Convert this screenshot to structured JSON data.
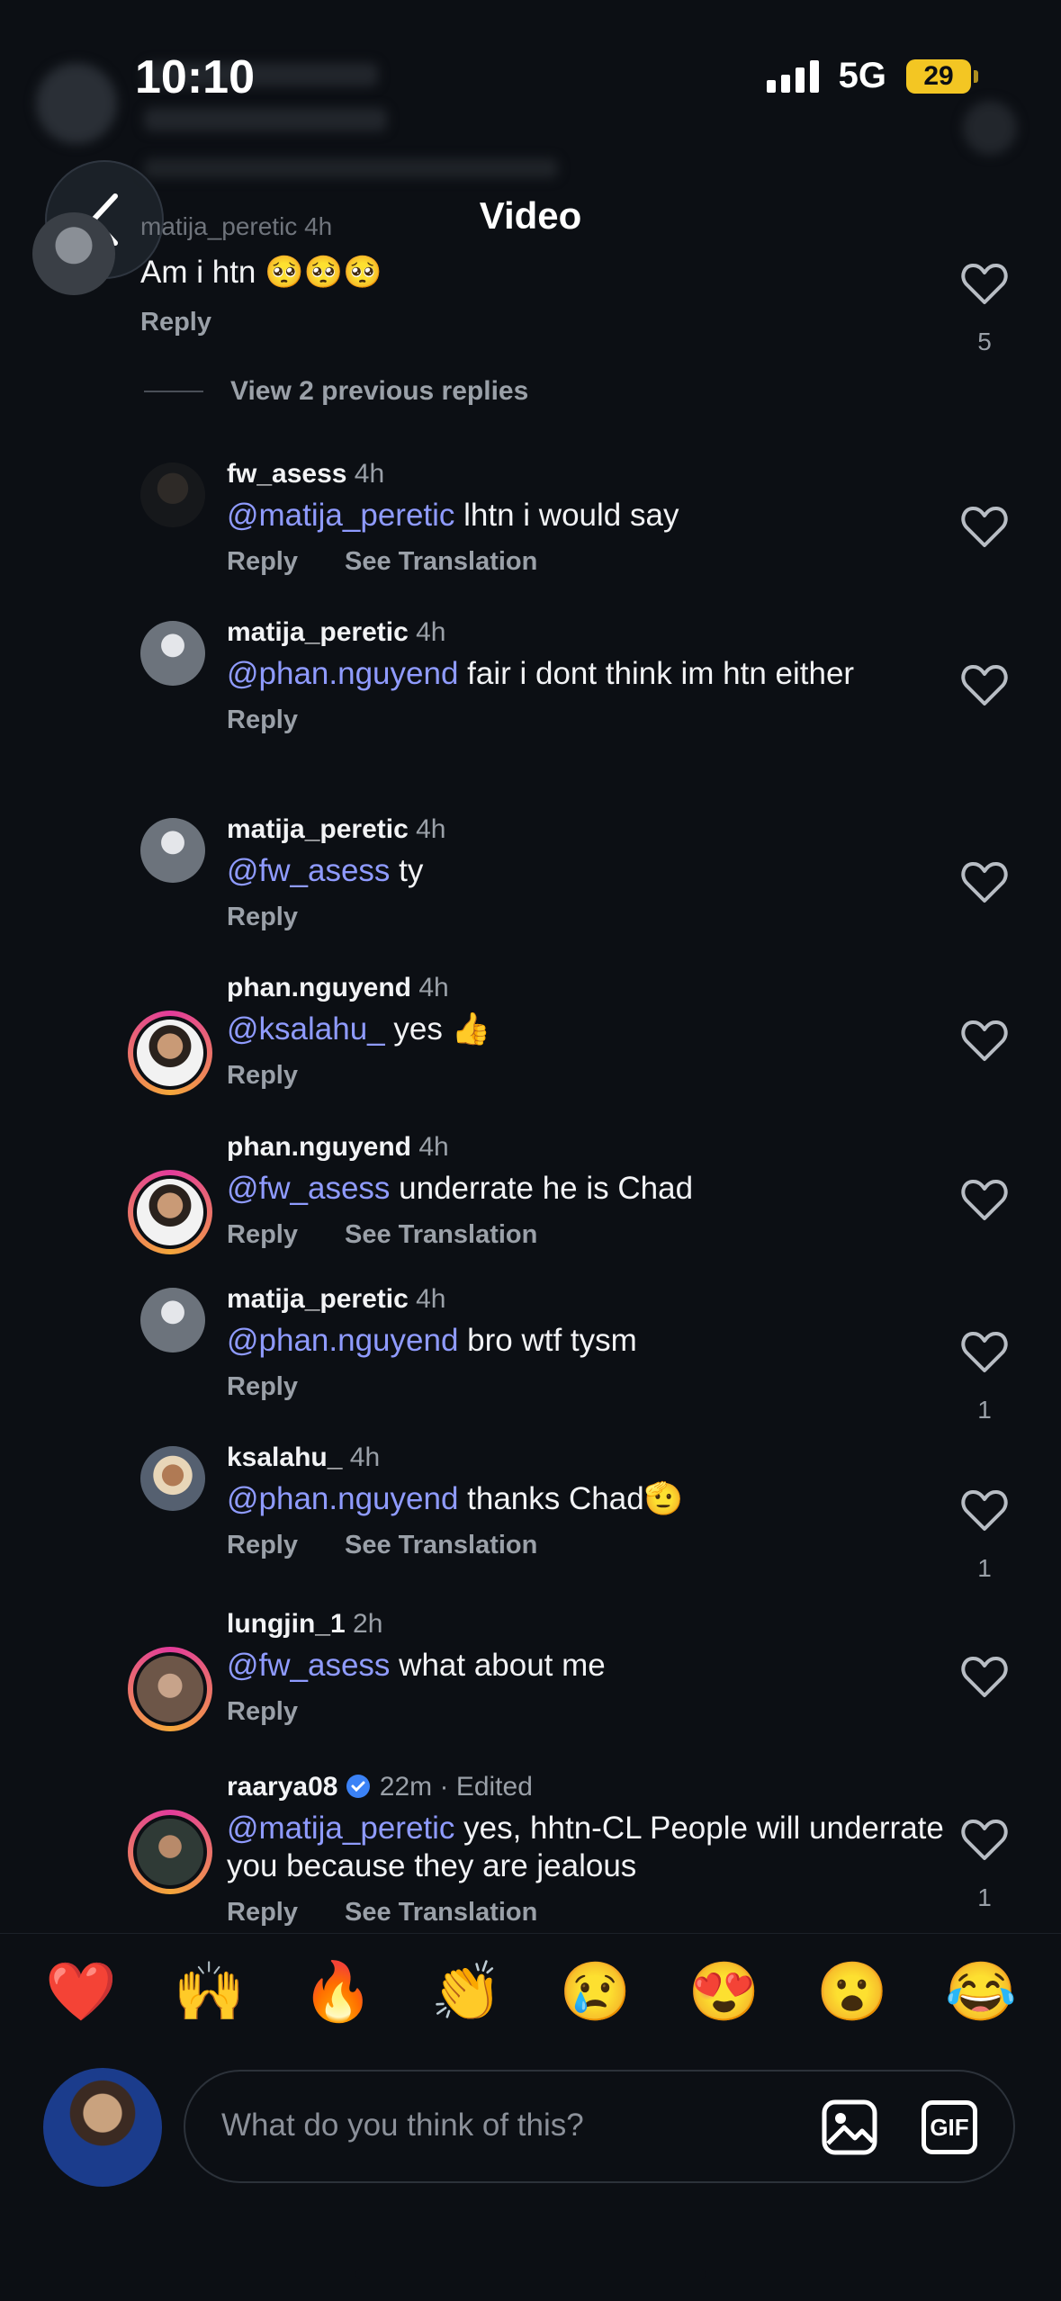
{
  "status": {
    "time": "10:10",
    "network": "5G",
    "battery": "29"
  },
  "header": {
    "title": "Video"
  },
  "parent_comment": {
    "user": "matija_peretic",
    "time": "4h",
    "text": "Am i htn 🥺🥺🥺",
    "reply": "Reply",
    "likes": "5"
  },
  "view_previous": "View 2 previous replies",
  "comments": [
    {
      "user": "fw_asess",
      "time": "4h",
      "mention": "@matija_peretic",
      "text": " lhtn i would say",
      "reply": "Reply",
      "translate": "See Translation",
      "likes": ""
    },
    {
      "user": "matija_peretic",
      "time": "4h",
      "mention": "@phan.nguyend",
      "text": " fair i dont think im htn either",
      "reply": "Reply",
      "translate": "",
      "likes": ""
    },
    {
      "user": "matija_peretic",
      "time": "4h",
      "mention": "@fw_asess",
      "text": " ty",
      "reply": "Reply",
      "translate": "",
      "likes": ""
    },
    {
      "user": "phan.nguyend",
      "time": "4h",
      "mention": "@ksalahu_",
      "text": " yes 👍",
      "reply": "Reply",
      "translate": "",
      "likes": ""
    },
    {
      "user": "phan.nguyend",
      "time": "4h",
      "mention": "@fw_asess",
      "text": " underrate he is Chad",
      "reply": "Reply",
      "translate": "See Translation",
      "likes": ""
    },
    {
      "user": "matija_peretic",
      "time": "4h",
      "mention": "@phan.nguyend",
      "text": "  bro wtf tysm",
      "reply": "Reply",
      "translate": "",
      "likes": "1"
    },
    {
      "user": "ksalahu_",
      "time": "4h",
      "mention": "@phan.nguyend",
      "text": " thanks Chad🫡",
      "reply": "Reply",
      "translate": "See Translation",
      "likes": "1"
    },
    {
      "user": "lungjin_1",
      "time": "2h",
      "mention": "@fw_asess",
      "text": " what about me",
      "reply": "Reply",
      "translate": "",
      "likes": ""
    },
    {
      "user": "raarya08",
      "time": "22m · Edited",
      "mention": "@matija_peretic",
      "text": " yes, hhtn-CL People will underrate you because they are jealous",
      "reply": "Reply",
      "translate": "See Translation",
      "likes": "1"
    }
  ],
  "reactions": [
    "❤️",
    "🙌",
    "🔥",
    "👏",
    "😢",
    "😍",
    "😮",
    "😂"
  ],
  "composer": {
    "placeholder": "What do you think of this?",
    "gif_label": "GIF"
  },
  "colors": {
    "background": "#0c0f14",
    "mention": "#8f9bff",
    "muted": "#9aa0a8",
    "verified": "#3b82f6"
  }
}
